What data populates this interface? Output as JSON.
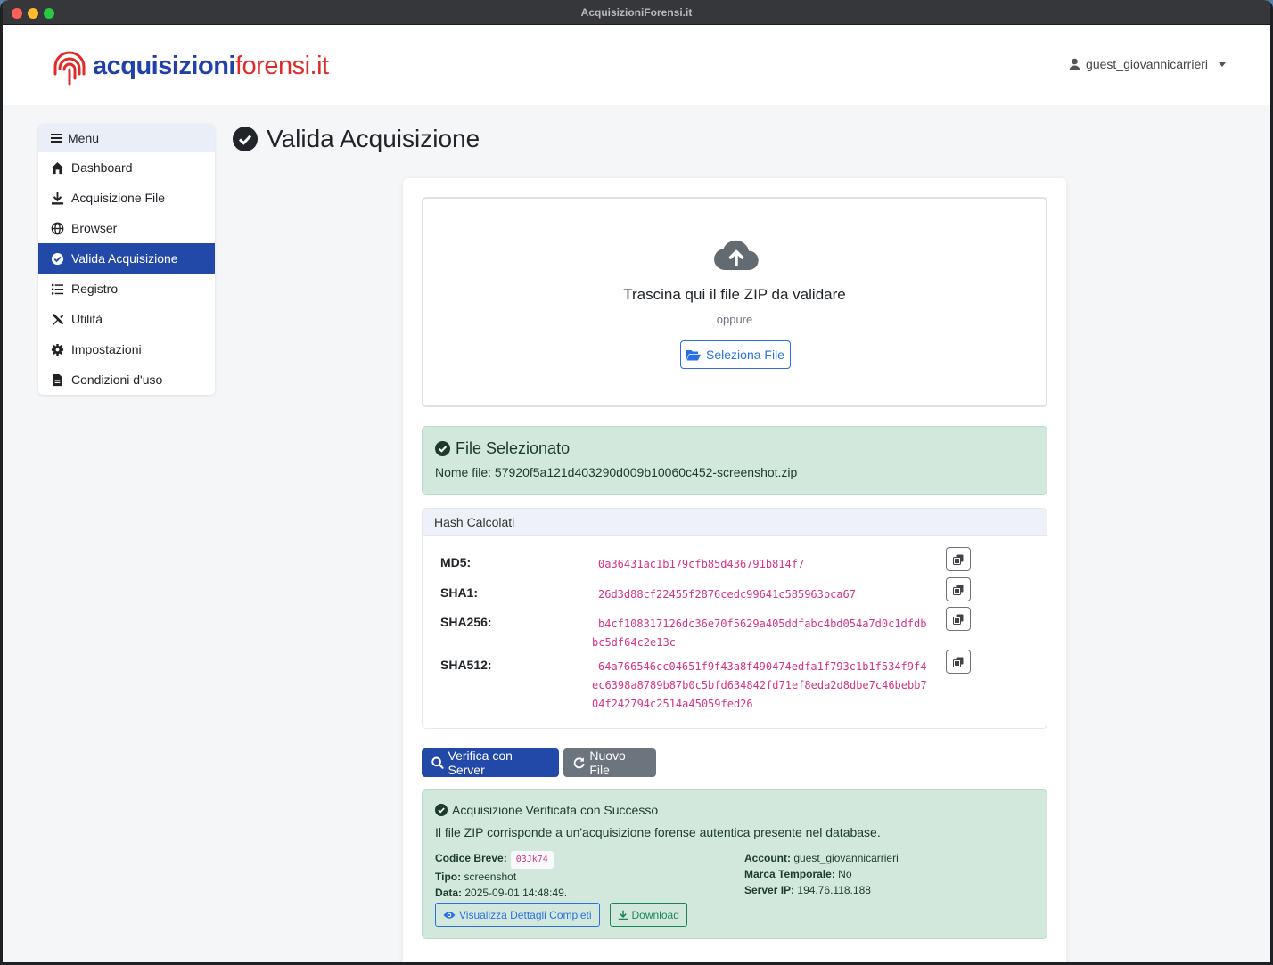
{
  "window": {
    "title": "AcquisizioniForensi.it"
  },
  "brand": {
    "part1": "acquisizioni",
    "part2": "forensi.it"
  },
  "user": {
    "name": "guest_giovannicarrieri"
  },
  "sidebar": {
    "header": "Menu",
    "items": [
      {
        "label": "Dashboard",
        "icon": "home-icon",
        "active": false
      },
      {
        "label": "Acquisizione File",
        "icon": "download-icon",
        "active": false
      },
      {
        "label": "Browser",
        "icon": "globe-icon",
        "active": false
      },
      {
        "label": "Valida Acquisizione",
        "icon": "check-circle-icon",
        "active": true
      },
      {
        "label": "Registro",
        "icon": "list-icon",
        "active": false
      },
      {
        "label": "Utilità",
        "icon": "tools-icon",
        "active": false
      },
      {
        "label": "Impostazioni",
        "icon": "gear-icon",
        "active": false
      },
      {
        "label": "Condizioni d'uso",
        "icon": "document-icon",
        "active": false
      }
    ]
  },
  "page": {
    "title": "Valida Acquisizione"
  },
  "dropzone": {
    "title": "Trascina qui il file ZIP da validare",
    "or": "oppure",
    "button": "Seleziona File"
  },
  "selected": {
    "title": "File Selezionato",
    "filename_label": "Nome file:",
    "filename": "57920f5a121d403290d009b10060c452-screenshot.zip"
  },
  "hashes": {
    "header": "Hash Calcolati",
    "rows": [
      {
        "label": "MD5:",
        "value": "0a36431ac1b179cfb85d436791b814f7"
      },
      {
        "label": "SHA1:",
        "value": "26d3d88cf22455f2876cedc99641c585963bca67"
      },
      {
        "label": "SHA256:",
        "value": "b4cf108317126dc36e70f5629a405ddfabc4bd054a7d0c1dfdbbc5df64c2e13c"
      },
      {
        "label": "SHA512:",
        "value": "64a766546cc04651f9f43a8f490474edfa1f793c1b1f534f9f4ec6398a8789b87b0c5bfd634842fd71ef8eda2d8dbe7c46bebb704f242794c2514a45059fed26"
      }
    ]
  },
  "actions": {
    "verify": "Verifica con Server",
    "new": "Nuovo File"
  },
  "result": {
    "title": "Acquisizione Verificata con Successo",
    "desc": "Il file ZIP corrisponde a un'acquisizione forense autentica presente nel database.",
    "left": [
      {
        "label": "Codice Breve:",
        "value": "03Jk74"
      },
      {
        "label": "Tipo:",
        "value": "screenshot"
      },
      {
        "label": "Data:",
        "value": "2025-09-01 14:48:49."
      }
    ],
    "right": [
      {
        "label": "Account:",
        "value": "guest_giovannicarrieri"
      },
      {
        "label": "Marca Temporale:",
        "value": "No"
      },
      {
        "label": "Server IP:",
        "value": "194.76.118.188"
      }
    ],
    "details_button": "Visualizza Dettagli Completi",
    "download_button": "Download"
  },
  "colors": {
    "primary": "#2349a8",
    "success_bg": "#d3e8dd",
    "brand_red": "#e02b2b"
  }
}
